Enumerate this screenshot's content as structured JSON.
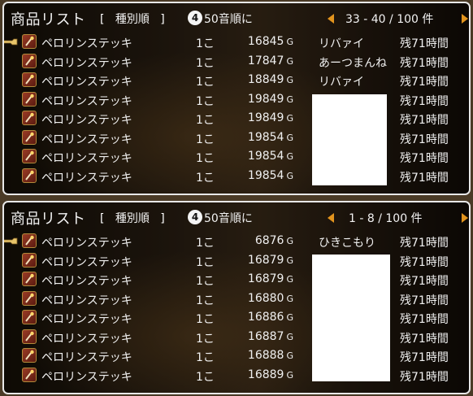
{
  "panels": [
    {
      "title": "商品リスト",
      "sort_open": "[",
      "sort_label": "種別順",
      "sort_close": "]",
      "order_number": "4",
      "order_label": "50音順に",
      "page_text": "33 - 40 / 100 件",
      "rows": [
        {
          "name": "ペロリンステッキ",
          "qty": "1こ",
          "price": "16845",
          "seller": "リバァイ",
          "time": "残71時間",
          "selected": true
        },
        {
          "name": "ペロリンステッキ",
          "qty": "1こ",
          "price": "17847",
          "seller": "あーつまんね",
          "time": "残71時間",
          "selected": false
        },
        {
          "name": "ペロリンステッキ",
          "qty": "1こ",
          "price": "18849",
          "seller": "リバァイ",
          "time": "残71時間",
          "selected": false
        },
        {
          "name": "ペロリンステッキ",
          "qty": "1こ",
          "price": "19849",
          "seller": "",
          "time": "残71時間",
          "selected": false
        },
        {
          "name": "ペロリンステッキ",
          "qty": "1こ",
          "price": "19849",
          "seller": "",
          "time": "残71時間",
          "selected": false
        },
        {
          "name": "ペロリンステッキ",
          "qty": "1こ",
          "price": "19854",
          "seller": "",
          "time": "残71時間",
          "selected": false
        },
        {
          "name": "ペロリンステッキ",
          "qty": "1こ",
          "price": "19854",
          "seller": "",
          "time": "残71時間",
          "selected": false
        },
        {
          "name": "ペロリンステッキ",
          "qty": "1こ",
          "price": "19854",
          "seller": "",
          "time": "残71時間",
          "selected": false
        }
      ]
    },
    {
      "title": "商品リスト",
      "sort_open": "[",
      "sort_label": "種別順",
      "sort_close": "]",
      "order_number": "4",
      "order_label": "50音順に",
      "page_text": "1 - 8 / 100 件",
      "rows": [
        {
          "name": "ペロリンステッキ",
          "qty": "1こ",
          "price": "6876",
          "seller": "ひきこもり",
          "time": "残71時間",
          "selected": true
        },
        {
          "name": "ペロリンステッキ",
          "qty": "1こ",
          "price": "16879",
          "seller": "",
          "time": "残71時間",
          "selected": false
        },
        {
          "name": "ペロリンステッキ",
          "qty": "1こ",
          "price": "16879",
          "seller": "",
          "time": "残71時間",
          "selected": false
        },
        {
          "name": "ペロリンステッキ",
          "qty": "1こ",
          "price": "16880",
          "seller": "",
          "time": "残71時間",
          "selected": false
        },
        {
          "name": "ペロリンステッキ",
          "qty": "1こ",
          "price": "16886",
          "seller": "",
          "time": "残71時間",
          "selected": false
        },
        {
          "name": "ペロリンステッキ",
          "qty": "1こ",
          "price": "16887",
          "seller": "",
          "time": "残71時間",
          "selected": false
        },
        {
          "name": "ペロリンステッキ",
          "qty": "1こ",
          "price": "16888",
          "seller": "",
          "time": "残71時間",
          "selected": false
        },
        {
          "name": "ペロリンステッキ",
          "qty": "1こ",
          "price": "16889",
          "seller": "",
          "time": "残71時間",
          "selected": false
        }
      ]
    }
  ],
  "currency": "G",
  "icons": {
    "item": "wand-icon",
    "cursor": "pointer-hand-icon",
    "prev": "arrow-left-icon",
    "next": "arrow-right-icon"
  },
  "colors": {
    "arrow": "#e2941e",
    "text": "#f0f0f0",
    "border": "#e8e8e8"
  }
}
